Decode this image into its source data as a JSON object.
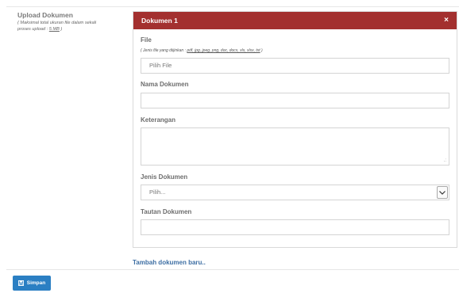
{
  "upload": {
    "title": "Upload Dokumen",
    "note_line1": "( Maksimal total ukuran file dalam sekali",
    "note_line2_prefix": "proses upload : ",
    "note_size": "5 MB",
    "note_line2_suffix": " )"
  },
  "card": {
    "title": "Dokumen 1",
    "close_glyph": "×",
    "file_label": "File",
    "file_note_prefix": "( Jenis file yang diijinkan : ",
    "file_note_types": "pdf, jpg, jpeg, png, doc, docx, xls, xlsx, txt",
    "file_note_suffix": " )",
    "file_placeholder": "Pilih File",
    "name_label": "Nama Dokumen",
    "name_value": "",
    "desc_label": "Keterangan",
    "desc_value": "",
    "type_label": "Jenis Dokumen",
    "type_selected": "Pilih...",
    "link_label": "Tautan Dokumen",
    "link_value": ""
  },
  "actions": {
    "add_document": "Tambah dokumen baru..",
    "save_label": "Simpan"
  },
  "colors": {
    "header_bg": "#a3302f",
    "save_bg": "#2b7fc3",
    "link": "#3d6ea3"
  },
  "icons": {
    "close": "close-icon",
    "select": "chevron-down-icon",
    "save": "save-icon"
  }
}
